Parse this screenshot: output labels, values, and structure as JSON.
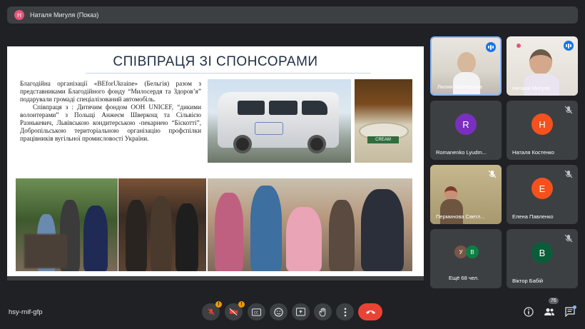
{
  "presenter_bar": {
    "avatar_letter": "Н",
    "title": "Наталя Мигуля (Показ)"
  },
  "slide": {
    "title": "СПІВПРАЦЯ ЗІ СПОНСОРАМИ",
    "paragraph1": "Благодійна організації «BEforUkraine» (Бельгія) разом з представниками Благодійного фонду “Милосердя та Здоров’я” подарували громаді спеціалізований автомобіль.",
    "paragraph2": "Співпраця з : Дитячим фондом ООН UNICEF, “дикими волонтерами” з Польщі Анжеєм Шверкощ та Сільвією Разнькевич, Львівською кондитерською -пекарнею “Біскотті”, Добропільською територіальною організацію профспілки працівників вугільної промисловості України.",
    "jar_label": "CREAM"
  },
  "participants": [
    {
      "name": "Лилия Кушнерова",
      "letter": "",
      "color": "",
      "speaking": true,
      "video": true
    },
    {
      "name": "Наталя Мигуля",
      "letter": "",
      "color": "",
      "speaking": true,
      "video": true
    },
    {
      "name": "Romanenko Lyudm...",
      "letter": "R",
      "color": "#7b2fbe",
      "speaking": false,
      "video": false
    },
    {
      "name": "Наталя Костенко",
      "letter": "Н",
      "color": "#f4511e",
      "speaking": false,
      "video": false
    },
    {
      "name": "Перминова Светл...",
      "letter": "",
      "color": "",
      "speaking": false,
      "video": true
    },
    {
      "name": "Елена Павленко",
      "letter": "Е",
      "color": "#f4511e",
      "speaking": false,
      "video": false
    },
    {
      "name": "Ещё 68 чел.",
      "letter": "",
      "color": "",
      "speaking": false,
      "video": false
    },
    {
      "name": "Віктор Бабій",
      "letter": "В",
      "color": "#0b5d3a",
      "speaking": false,
      "video": false
    }
  ],
  "more_avatars": {
    "a": "У",
    "a_color": "#795548",
    "b": "В",
    "b_color": "#0b8043"
  },
  "bottom": {
    "meeting_code": "hsy-rnif-gfp",
    "participants_count": "76",
    "warn": "!"
  },
  "colors": {
    "accent": "#8ab4f8",
    "danger": "#ea4335",
    "tile": "#3c4043",
    "bg": "#202124"
  }
}
